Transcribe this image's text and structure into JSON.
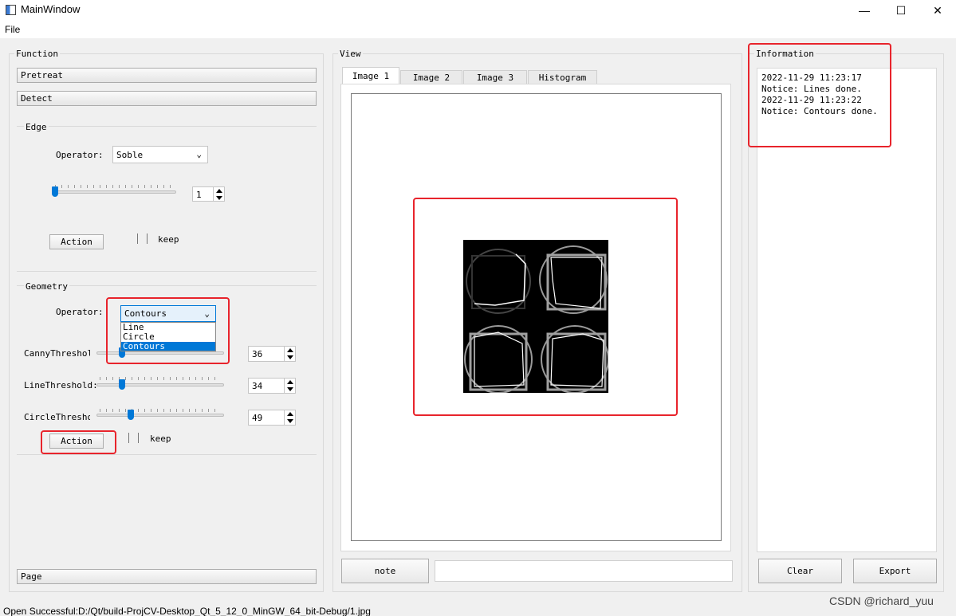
{
  "window": {
    "title": "MainWindow",
    "min": "—",
    "max": "☐",
    "close": "✕"
  },
  "menu": {
    "file": "File"
  },
  "function": {
    "title": "Function",
    "pretreat": "Pretreat",
    "detect": "Detect",
    "edge": {
      "title": "Edge",
      "operator_label": "Operator:",
      "operator_value": "Soble",
      "spin_value": "1",
      "action": "Action",
      "keep": "keep"
    },
    "geometry": {
      "title": "Geometry",
      "operator_label": "Operator:",
      "operator_value": "Contours",
      "options": [
        "Line",
        "Circle",
        "Contours"
      ],
      "canny_label": "CannyThreshold",
      "canny_value": "36",
      "line_label": "LineThreshold:",
      "line_value": "34",
      "circle_label": "CircleThreshold",
      "circle_value": "49",
      "action": "Action",
      "keep": "keep"
    },
    "page": "Page"
  },
  "view": {
    "title": "View",
    "tabs": [
      "Image 1",
      "Image 2",
      "Image 3",
      "Histogram"
    ],
    "active_tab": "Image 1",
    "note": "note",
    "note_input": ""
  },
  "information": {
    "title": "Information",
    "log": [
      "2022-11-29 11:23:17",
      "Notice: Lines done.",
      "2022-11-29 11:23:22",
      "Notice: Contours done."
    ],
    "clear": "Clear",
    "export": "Export"
  },
  "status": {
    "text": "Open Successful:D:/Qt/build-ProjCV-Desktop_Qt_5_12_0_MinGW_64_bit-Debug/1.jpg"
  },
  "watermark": "CSDN @richard_yuu",
  "colors": {
    "accent": "#0078d7",
    "highlight": "#e8242c",
    "selection": "#0078d7"
  }
}
